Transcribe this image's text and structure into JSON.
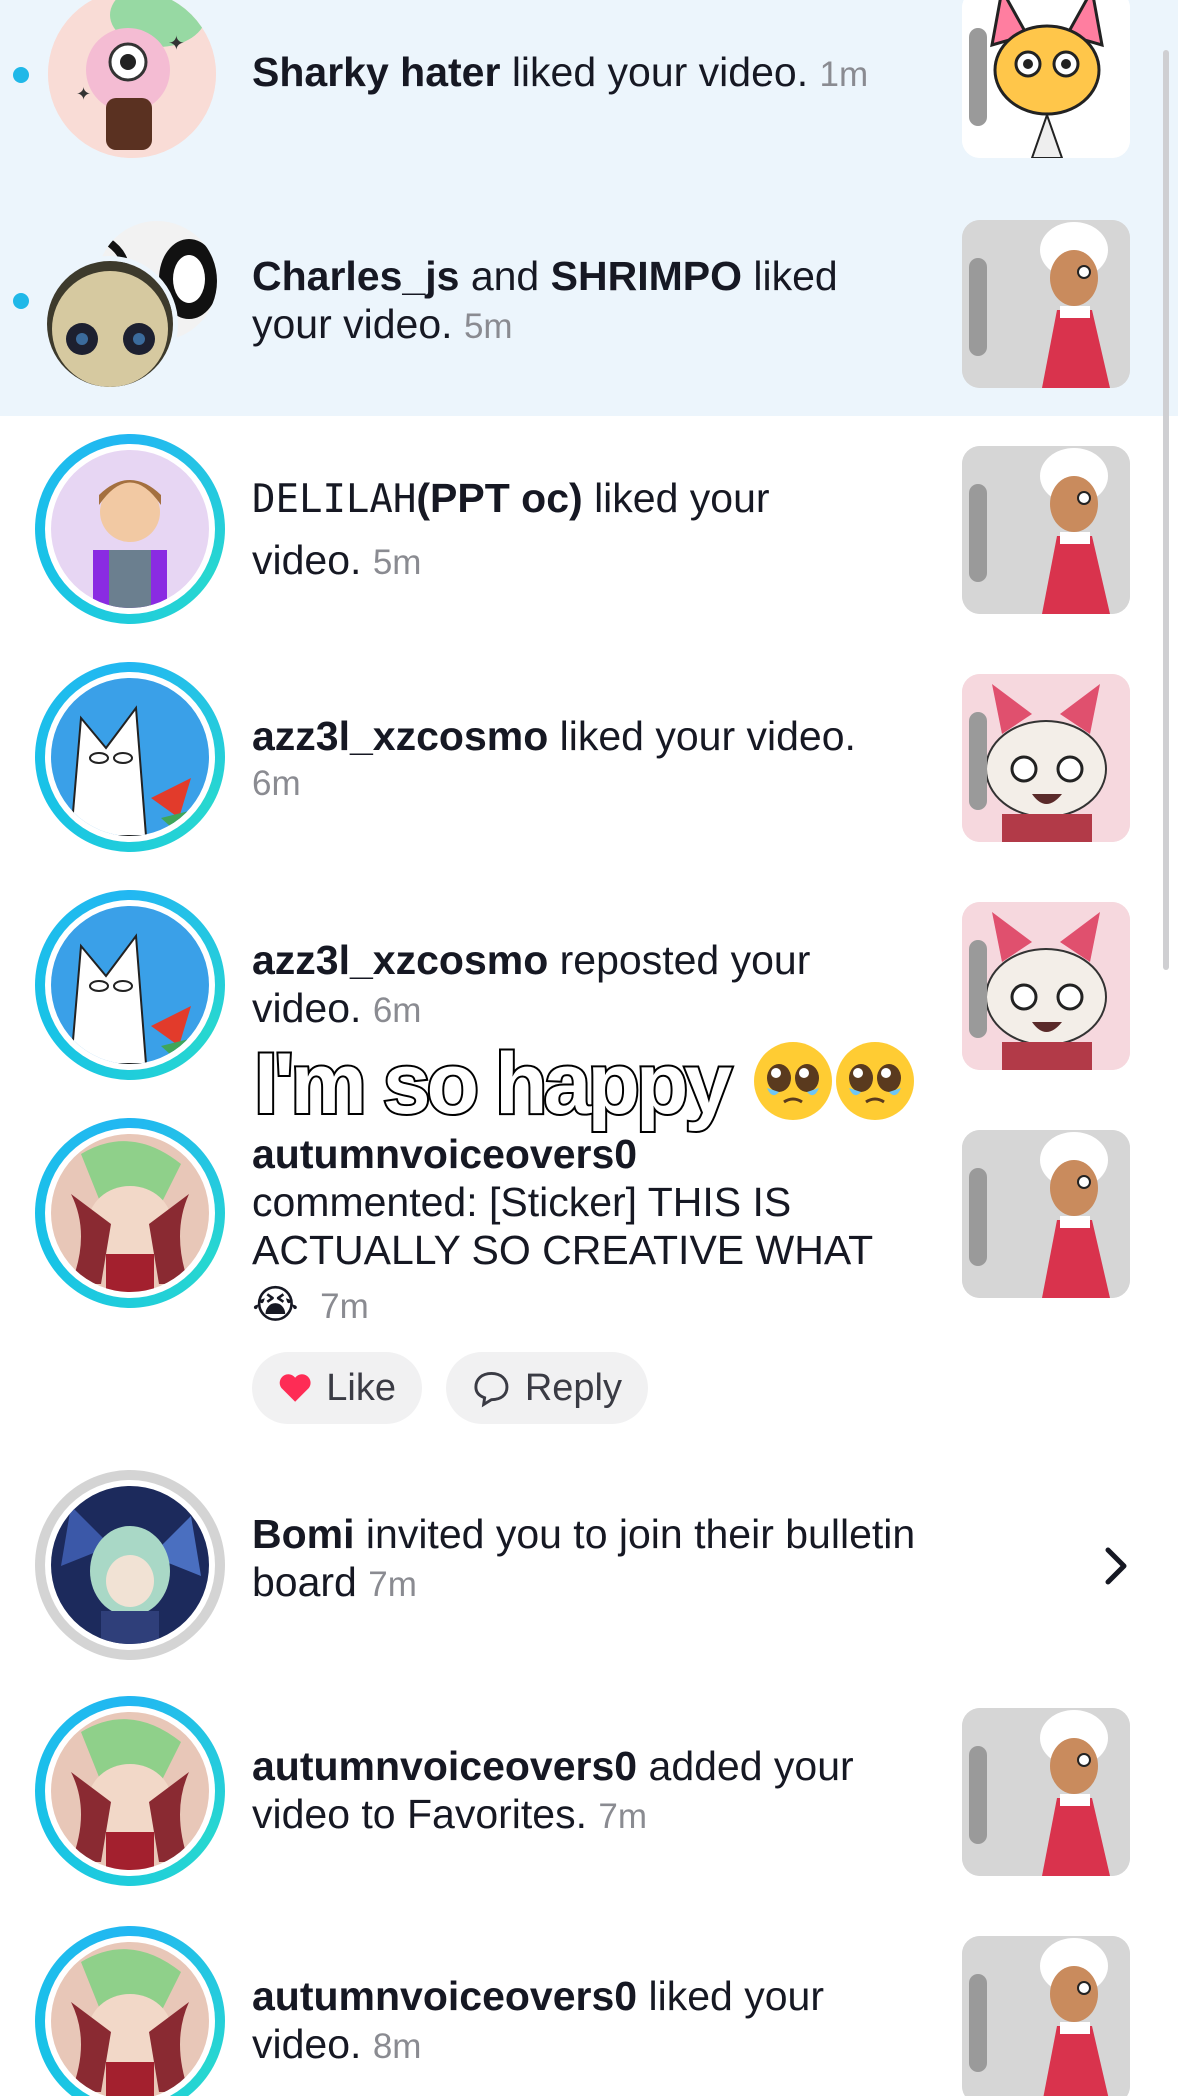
{
  "notifications": [
    {
      "unread": true,
      "user": "Sharky hater",
      "action": "liked your video.",
      "time": "1m"
    },
    {
      "unread": true,
      "user1": "Charles_js",
      "joiner": "and",
      "user2": "SHRIMPO",
      "action": "liked",
      "action2": "your video.",
      "time": "5m"
    },
    {
      "user_plain": "DELILAH",
      "user_bold": "(PPT oc)",
      "action": "liked your",
      "action2": "video.",
      "time": "5m"
    },
    {
      "user": "azz3l_xzcosmo",
      "action": "liked your video.",
      "time": "6m"
    },
    {
      "user": "azz3l_xzcosmo",
      "action": "reposted your",
      "action2": "video.",
      "time": "6m"
    },
    {
      "user": "autumnvoiceovers0",
      "action": "commented: [Sticker] THIS IS",
      "action2": "ACTUALLY SO CREATIVE WHAT",
      "emoji": "😭",
      "time": "7m",
      "like_label": "Like",
      "reply_label": "Reply"
    },
    {
      "user": "Bomi",
      "action": "invited you to join their bulletin",
      "action2": "board",
      "time": "7m"
    },
    {
      "user": "autumnvoiceovers0",
      "action": "added your",
      "action2": "video to Favorites.",
      "time": "7m"
    },
    {
      "user": "autumnvoiceovers0",
      "action": "liked your",
      "action2": "video.",
      "time": "8m"
    }
  ],
  "overlay_caption": "I'm so happy",
  "overlay_emoji": "🥹🥹",
  "colors": {
    "unread_bg": "#ecf5fc",
    "unread_dot": "#20b8e8",
    "ring": "#22b7f2",
    "like_heart": "#fe2c55",
    "time": "#8a8b91"
  },
  "icons": [
    "heart-icon",
    "comment-bubble-icon",
    "chevron-right-icon"
  ]
}
